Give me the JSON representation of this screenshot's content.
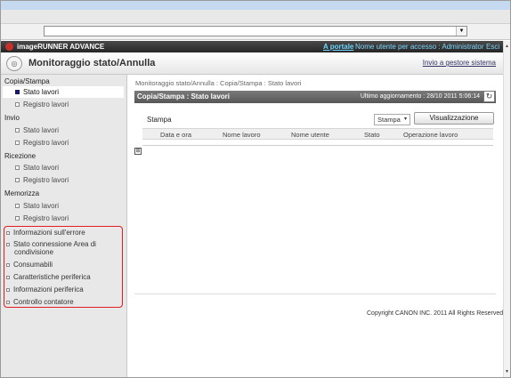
{
  "header": {
    "brand": "imageRUNNER ADVANCE",
    "portal_link": "A portale",
    "user_info": "Nome utente per accesso : Administrator",
    "logout": "Esci"
  },
  "title_bar": {
    "title": "Monitoraggio stato/Annulla",
    "send_admin": "Invio a gestore sistema"
  },
  "sidebar": {
    "sections": [
      {
        "label": "Copia/Stampa",
        "items": [
          "Stato lavori",
          "Registro lavori"
        ]
      },
      {
        "label": "Invio",
        "items": [
          "Stato lavori",
          "Registro lavori"
        ]
      },
      {
        "label": "Ricezione",
        "items": [
          "Stato lavori",
          "Registro lavori"
        ]
      },
      {
        "label": "Memorizza",
        "items": [
          "Stato lavori",
          "Registro lavori"
        ]
      }
    ],
    "info_items": [
      "Informazioni sull'errore",
      "Stato connessione Area di",
      "condivisione",
      "Consumabili",
      "Caratteristiche periferica",
      "Informazioni periferica",
      "Controllo contatore"
    ]
  },
  "main": {
    "breadcrumb": "Monitoraggio stato/Annulla : Copia/Stampa : Stato lavori",
    "panel_title": "Copia/Stampa : Stato lavori",
    "last_update": "Ultimo aggiornamento : 28/10 2011 5:06:14",
    "stampa_label": "Stampa",
    "select_value": "Stampa",
    "view_button": "Visualizzazione",
    "columns": [
      "Data e ora",
      "Nome lavoro",
      "Nome utente",
      "Stato",
      "Operazione lavoro"
    ]
  },
  "footer": {
    "copyright": "Copyright CANON INC. 2011 All Rights Reserved"
  },
  "colors": {
    "header_bg": "#2e2e2e",
    "link_color": "#6fd7ff",
    "highlight_box": "#e31b23"
  }
}
